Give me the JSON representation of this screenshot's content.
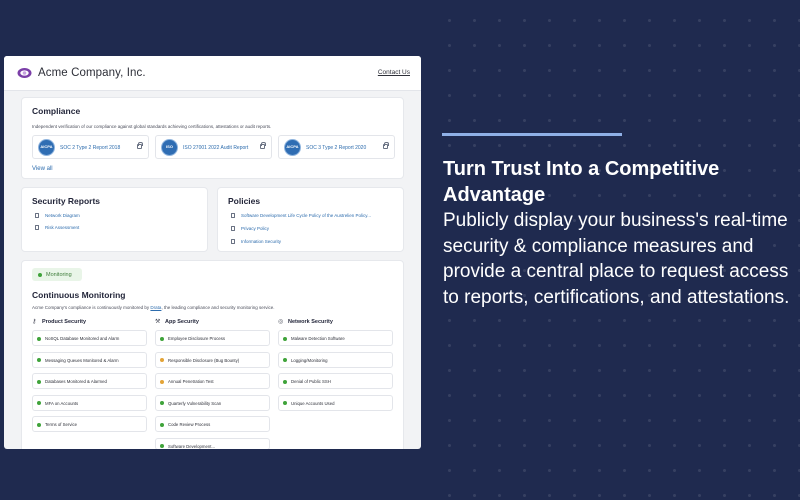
{
  "header": {
    "company_name": "Acme Company, Inc.",
    "contact_link": "Contact Us"
  },
  "compliance": {
    "title": "Compliance",
    "description": "Independent verification of our compliance against global standards achieving certifications, attestations or audit reports.",
    "reports": [
      {
        "label": "SOC 2 Type 2 Report 2018",
        "badge": "AICPA"
      },
      {
        "label": "ISO 27001 2022 Audit Report",
        "badge": "ISO"
      },
      {
        "label": "SOC 3 Type 2 Report 2020",
        "badge": "AICPA"
      }
    ],
    "view_all": "View all"
  },
  "security_reports": {
    "title": "Security Reports",
    "items": [
      "Network Diagram",
      "Risk Assessment"
    ]
  },
  "policies": {
    "title": "Policies",
    "items": [
      "Software Development Life Cycle Policy of the Austrelien Policy...",
      "Privacy Policy",
      "Information Security"
    ]
  },
  "monitoring": {
    "chip": "Monitoring",
    "title": "Continuous Monitoring",
    "desc_prefix": "Acme Company's compliance is continuously monitored by ",
    "desc_link": "Drata",
    "desc_suffix": ", the leading compliance and security monitoring service.",
    "columns": [
      {
        "title": "Product Security",
        "icon": "key-icon",
        "items": [
          {
            "label": "NoSQL Database Monitored and Alarm",
            "status": "green"
          },
          {
            "label": "Messaging Queues Monitored & Alarm",
            "status": "green"
          },
          {
            "label": "Databases Monitored & Alarmed",
            "status": "green"
          },
          {
            "label": "MFA on Accounts",
            "status": "green"
          },
          {
            "label": "Terms of Service",
            "status": "green"
          }
        ]
      },
      {
        "title": "App Security",
        "icon": "wrench-icon",
        "items": [
          {
            "label": "Employee Disclosure Process",
            "status": "green"
          },
          {
            "label": "Responsible Disclosure (Bug Bounty)",
            "status": "yellow"
          },
          {
            "label": "Annual Penetration Test",
            "status": "yellow"
          },
          {
            "label": "Quarterly Vulnerability Scan",
            "status": "green"
          },
          {
            "label": "Code Review Process",
            "status": "green"
          },
          {
            "label": "Software Development...",
            "status": "green"
          }
        ]
      },
      {
        "title": "Network Security",
        "icon": "globe-icon",
        "items": [
          {
            "label": "Malware Detection Software",
            "status": "green"
          },
          {
            "label": "Logging/Monitoring",
            "status": "green"
          },
          {
            "label": "Denial of Public SSH",
            "status": "green"
          },
          {
            "label": "Unique Accounts Used",
            "status": "green"
          }
        ]
      }
    ]
  },
  "promo": {
    "headline": "Turn Trust Into a Competitive Advantage",
    "body": "Publicly display your business's real-time security & compliance measures and provide a central place to request access to reports, certifications, and attestations."
  },
  "colors": {
    "background": "#1f2a4f",
    "accent_bar": "#8fb0e6",
    "link": "#2d6cad",
    "status_green": "#3fa33a",
    "status_yellow": "#e3a437",
    "logo_purple": "#7b3fa8"
  }
}
